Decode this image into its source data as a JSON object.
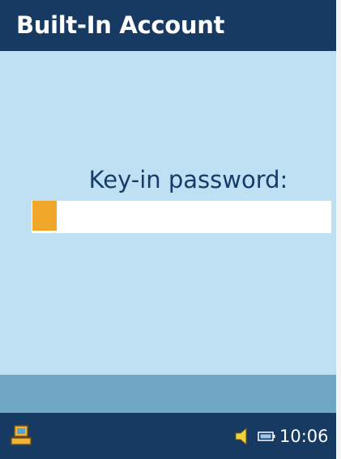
{
  "window": {
    "title": "Built-In Account"
  },
  "main": {
    "prompt": "Key-in password:",
    "password_value": ""
  },
  "status_bar": {
    "time": "10:06",
    "start_icon": "start-icon",
    "volume_icon": "speaker-icon",
    "battery_icon": "battery-icon"
  },
  "colors": {
    "title_bar": "#173a63",
    "content_bg": "#bfe0f3",
    "softkey_bar": "#6fa6c6",
    "caret": "#f0a628",
    "prompt_text": "#173c6a"
  }
}
